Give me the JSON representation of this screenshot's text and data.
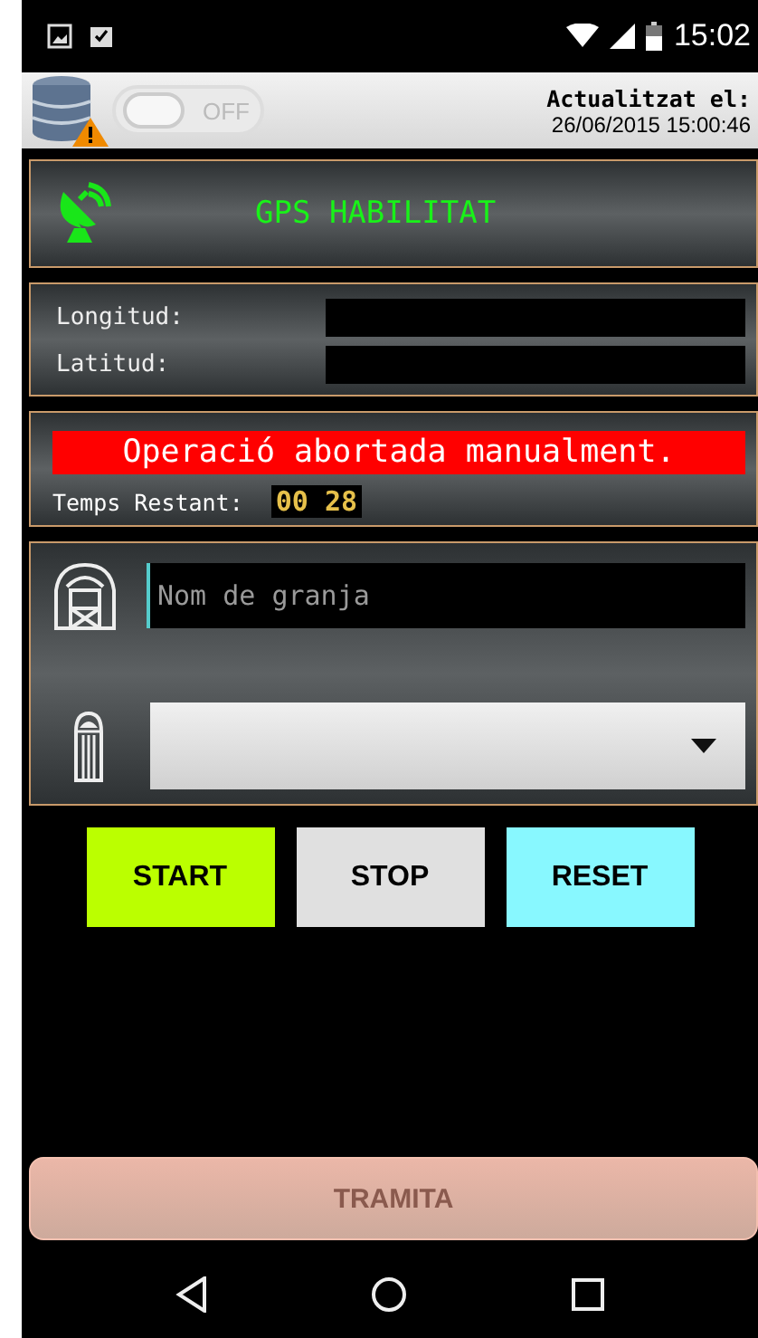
{
  "status_bar": {
    "time": "15:02"
  },
  "header": {
    "sync_toggle": {
      "label": "OFF",
      "on": false
    },
    "updated_label": "Actualitzat el:",
    "updated_time": "26/06/2015 15:00:46"
  },
  "gps": {
    "label": "GPS HABILITAT"
  },
  "coordinates": [
    {
      "label": "Longitud:"
    },
    {
      "label": "Latitud:"
    }
  ],
  "message": {
    "text": "Operació abortada manualment.",
    "timer_label": "Temps Restant:",
    "timer": "00 28"
  },
  "farm": {
    "name_placeholder": "Nom de granja"
  },
  "buttons": [
    {
      "label": "START",
      "color": "#bbff00"
    },
    {
      "label": "STOP",
      "color": "#e0e0e0"
    },
    {
      "label": "RESET",
      "color": "#88f8ff"
    }
  ],
  "submit": {
    "label": "TRAMITA",
    "disabled": true
  }
}
